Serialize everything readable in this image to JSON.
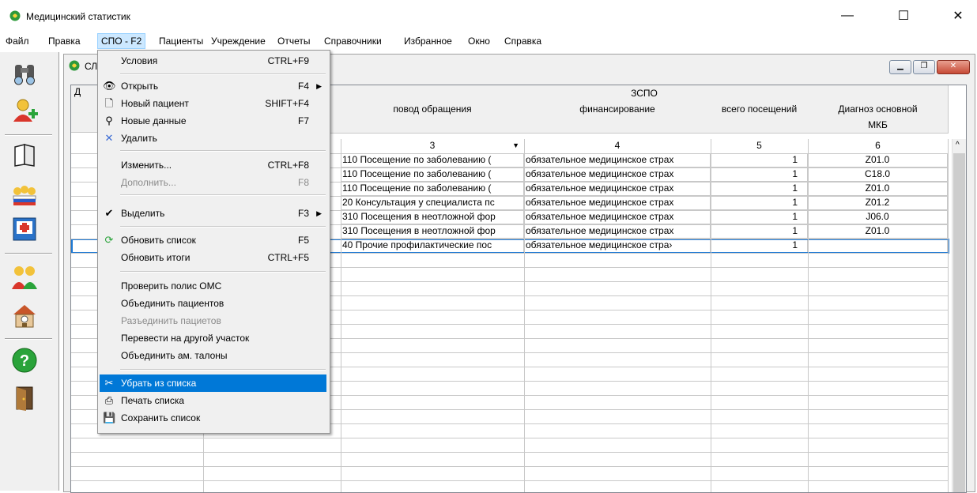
{
  "app": {
    "title": "Медицинский статистик"
  },
  "window_controls": {
    "minimize": "—",
    "maximize": "☐",
    "close": "✕"
  },
  "menubar": [
    {
      "label": "Файл"
    },
    {
      "label": "Правка"
    },
    {
      "label": "СПО - F2"
    },
    {
      "label": "Пациенты"
    },
    {
      "label": "Учреждение"
    },
    {
      "label": "Отчеты"
    },
    {
      "label": "Справочники"
    },
    {
      "label": "Избранное"
    },
    {
      "label": "Окно"
    },
    {
      "label": "Справка"
    }
  ],
  "child_window": {
    "caption": "СЛ"
  },
  "grid": {
    "group_header": "ЗСПО",
    "col_a_header": "Д",
    "headers": [
      "повод обращения",
      "финансирование",
      "всего посещений",
      "Диагноз основной"
    ],
    "subheader_mkb": "МКБ",
    "col_numbers": [
      "3",
      "4",
      "5",
      "6"
    ],
    "rows": [
      {
        "reason": "110 Посещение по заболеванию (",
        "fin": "обязательное медицинское страх",
        "visits": "1",
        "mkb": "Z01.0"
      },
      {
        "reason": "110 Посещение по заболеванию (",
        "fin": "обязательное медицинское страх",
        "visits": "1",
        "mkb": "C18.0"
      },
      {
        "reason": "110 Посещение по заболеванию (",
        "fin": "обязательное медицинское страх",
        "visits": "1",
        "mkb": "Z01.0"
      },
      {
        "reason": "20 Консультация у специалиста пс",
        "fin": "обязательное медицинское страх",
        "visits": "1",
        "mkb": "Z01.2"
      },
      {
        "reason": "310 Посещения в неотложной фор",
        "fin": "обязательное медицинское страх",
        "visits": "1",
        "mkb": "J06.0"
      },
      {
        "reason": "310 Посещения в неотложной фор",
        "fin": "обязательное медицинское страх",
        "visits": "1",
        "mkb": "Z01.0"
      },
      {
        "reason": "40 Прочие профилактические пос",
        "fin": "обязательное медицинское стра›",
        "visits": "1",
        "mkb": ""
      }
    ]
  },
  "dropdown": {
    "items": [
      {
        "label": "Условия",
        "shortcut": "CTRL+F9"
      },
      {
        "label": "Открыть",
        "shortcut": "F4",
        "submenu": "▶"
      },
      {
        "label": "Новый пациент",
        "shortcut": "SHIFT+F4"
      },
      {
        "label": "Новые данные",
        "shortcut": "F7"
      },
      {
        "label": "Удалить",
        "shortcut": ""
      },
      {
        "label": "Изменить...",
        "shortcut": "CTRL+F8"
      },
      {
        "label": "Дополнить...",
        "shortcut": "F8"
      },
      {
        "label": "Выделить",
        "shortcut": "F3",
        "submenu": "▶"
      },
      {
        "label": "Обновить список",
        "shortcut": "F5"
      },
      {
        "label": "Обновить итоги",
        "shortcut": "CTRL+F5"
      },
      {
        "label": "Проверить полис ОМС",
        "shortcut": ""
      },
      {
        "label": "Объединить пациентов",
        "shortcut": ""
      },
      {
        "label": "Разъединить пациетов",
        "shortcut": ""
      },
      {
        "label": "Перевести на другой участок",
        "shortcut": ""
      },
      {
        "label": "Объединить ам. талоны",
        "shortcut": ""
      },
      {
        "label": "Убрать из списка",
        "shortcut": ""
      },
      {
        "label": "Печать списка",
        "shortcut": ""
      },
      {
        "label": "Сохранить список",
        "shortcut": ""
      }
    ]
  },
  "colors": {
    "selection_blue": "#0078d7",
    "row_highlight": "#1c78d4",
    "menu_active_bg": "#cce8ff"
  }
}
